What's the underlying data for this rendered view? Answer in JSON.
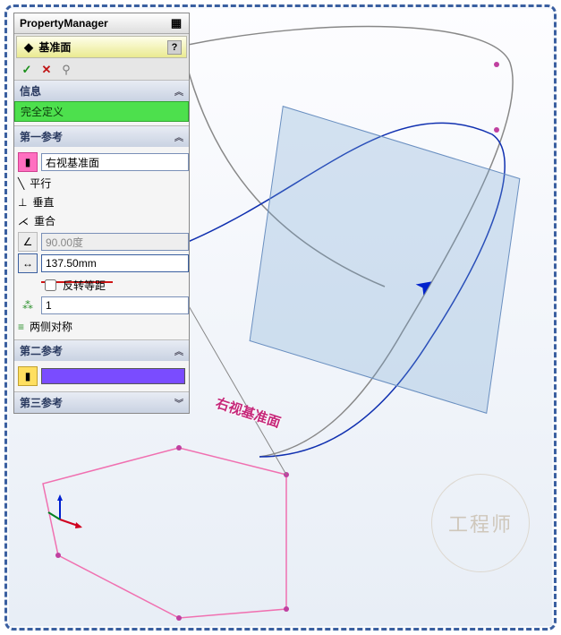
{
  "pm_title": "PropertyManager",
  "feature": {
    "name": "基准面",
    "help": "?"
  },
  "confirm": {
    "ok": "✓",
    "cancel": "✕",
    "pin": "📌"
  },
  "sections": {
    "info": {
      "title": "信息",
      "status": "完全定义"
    },
    "ref1": {
      "title": "第一参考",
      "entity": "右视基准面",
      "constraints": {
        "parallel": "平行",
        "perpendicular": "垂直",
        "coincident": "重合"
      },
      "angle": "90.00度",
      "distance": "137.50mm",
      "reverse_label": "反转等距",
      "reverse_checked": false,
      "instances": "1",
      "midplane": "两侧对称"
    },
    "ref2": {
      "title": "第二参考",
      "entity": ""
    },
    "ref3": {
      "title": "第三参考"
    }
  },
  "viewport": {
    "plane_label": "右视基准面",
    "watermark": "工程师"
  },
  "colors": {
    "accent": "#3a5fa0",
    "status_ok": "#4de04d",
    "entity_sel": "#ffe0ef",
    "highlight_red": "#d01515"
  }
}
